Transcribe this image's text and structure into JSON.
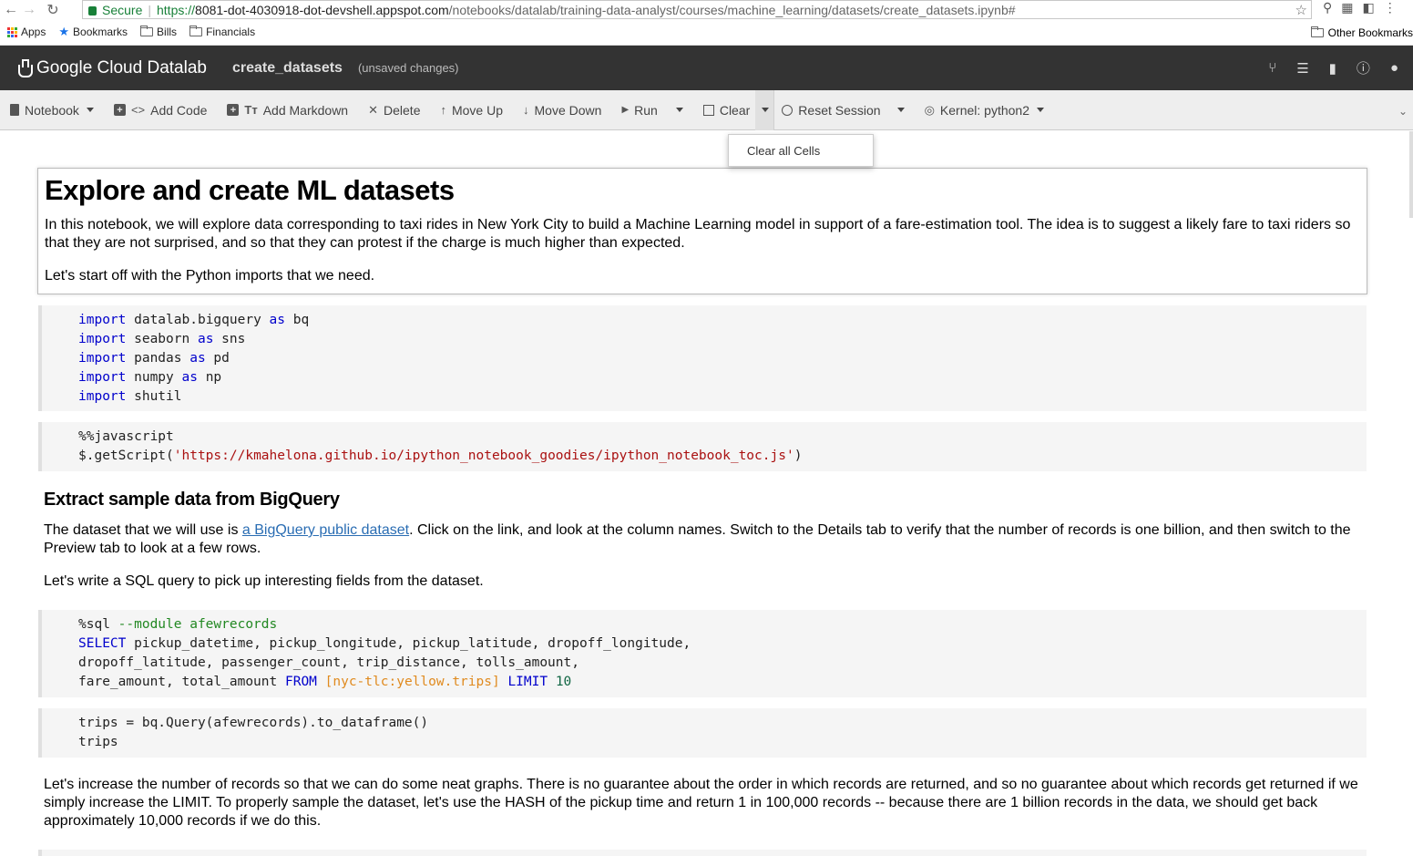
{
  "browser": {
    "secure_label": "Secure",
    "url_scheme": "https://",
    "url_host": "8081-dot-4030918-dot-devshell.appspot.com",
    "url_path": "/notebooks/datalab/training-data-analyst/courses/machine_learning/datasets/create_datasets.ipynb#",
    "bookmarks": [
      "Apps",
      "Bookmarks",
      "Bills",
      "Financials"
    ],
    "other_bookmarks": "Other Bookmarks"
  },
  "header": {
    "app_name": "Google Cloud Datalab",
    "notebook_name": "create_datasets",
    "status": "(unsaved changes)"
  },
  "toolbar": {
    "notebook": "Notebook",
    "add_code": "Add Code",
    "add_markdown": "Add Markdown",
    "delete": "Delete",
    "move_up": "Move Up",
    "move_down": "Move Down",
    "run": "Run",
    "clear": "Clear",
    "reset_session": "Reset Session",
    "kernel": "Kernel: python2"
  },
  "dropdown": {
    "clear_all": "Clear all Cells"
  },
  "cells": {
    "title": "Explore and create ML datasets",
    "intro": "In this notebook, we will explore data corresponding to taxi rides in New York City to build a Machine Learning model in support of a fare-estimation tool. The idea is to suggest a likely fare to taxi riders so that they are not surprised, and so that they can protest if the charge is much higher than expected.",
    "imports_note": "Let's start off with the Python imports that we need.",
    "imports": [
      {
        "kw": "import",
        "mod": " datalab.bigquery ",
        "as": "as",
        "alias": " bq"
      },
      {
        "kw": "import",
        "mod": " seaborn ",
        "as": "as",
        "alias": " sns"
      },
      {
        "kw": "import",
        "mod": " pandas ",
        "as": "as",
        "alias": " pd"
      },
      {
        "kw": "import",
        "mod": " numpy ",
        "as": "as",
        "alias": " np"
      },
      {
        "kw": "import",
        "mod": " shutil",
        "as": "",
        "alias": ""
      }
    ],
    "js_magic": "%%javascript",
    "js_call_pre": "$.getScript(",
    "js_call_str": "'https://kmahelona.github.io/ipython_notebook_goodies/ipython_notebook_toc.js'",
    "js_call_post": ")",
    "h2_extract": "Extract sample data from BigQuery",
    "dataset_pre": "The dataset that we will use is ",
    "dataset_link": "a BigQuery public dataset",
    "dataset_post": ". Click on the link, and look at the column names. Switch to the Details tab to verify that the number of records is one billion, and then switch to the Preview tab to look at a few rows.",
    "sql_note": "Let's write a SQL query to pick up interesting fields from the dataset.",
    "sql_magic": "%sql",
    "sql_module": " --module afewrecords",
    "sql_select": "SELECT",
    "sql_l1": " pickup_datetime, pickup_longitude, pickup_latitude, dropoff_longitude,",
    "sql_l2": "dropoff_latitude, passenger_count, trip_distance, tolls_amount,",
    "sql_l3a": "fare_amount, total_amount ",
    "sql_from": "FROM",
    "sql_table": "[nyc-tlc:yellow.trips]",
    "sql_limit": "LIMIT",
    "sql_limit_n": "10",
    "trips_l1": "trips = bq.Query(afewrecords).to_dataframe()",
    "trips_l2": "trips",
    "increase_note": "Let's increase the number of records so that we can do some neat graphs. There is no guarantee about the order in which records are returned, and so no guarantee about which records get returned if we simply increase the LIMIT. To properly sample the dataset, let's use the HASH of the pickup time and return 1 in 100,000 records -- because there are 1 billion records in the data, we should get back approximately 10,000 records if we do this."
  }
}
